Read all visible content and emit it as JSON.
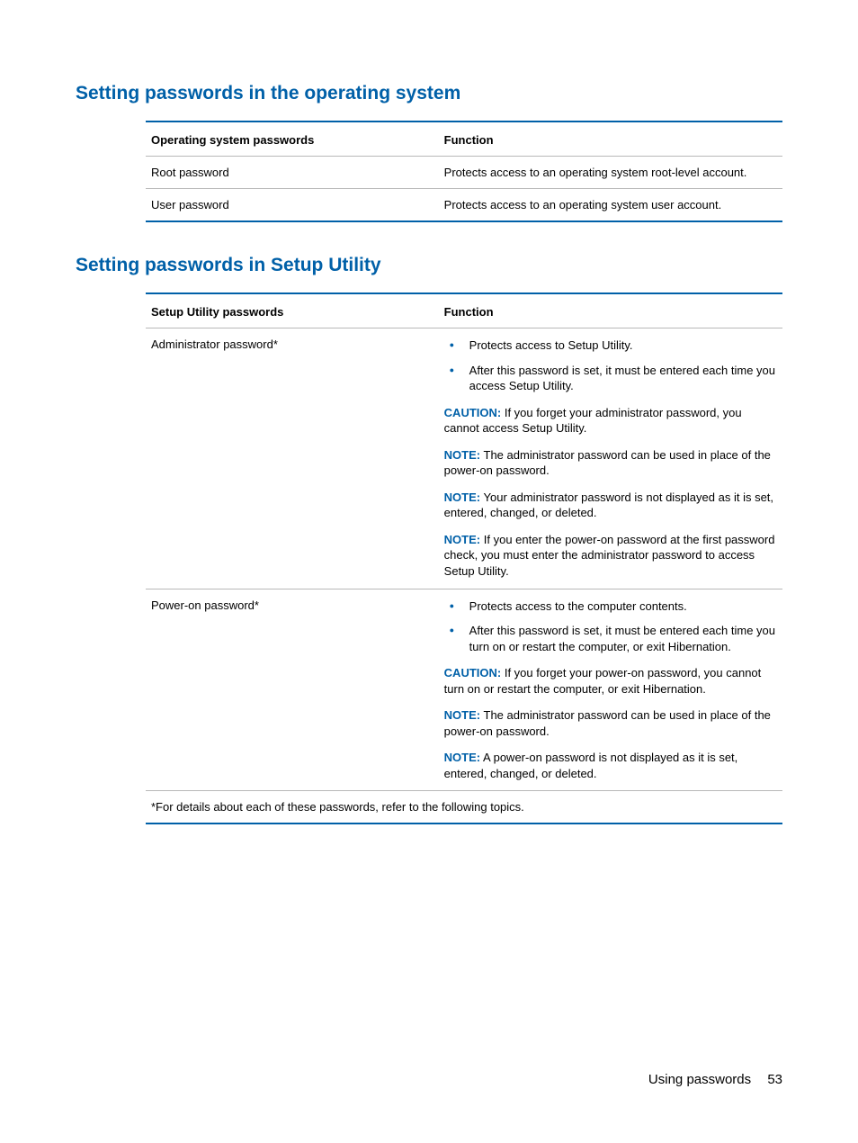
{
  "sections": {
    "os": {
      "heading": "Setting passwords in the operating system",
      "table": {
        "headers": [
          "Operating system passwords",
          "Function"
        ],
        "rows": [
          {
            "name": "Root password",
            "func": "Protects access to an operating system root-level account."
          },
          {
            "name": "User password",
            "func": "Protects access to an operating system user account."
          }
        ]
      }
    },
    "setup": {
      "heading": "Setting passwords in Setup Utility",
      "table": {
        "headers": [
          "Setup Utility passwords",
          "Function"
        ],
        "rows": [
          {
            "name": "Administrator password*",
            "bullets": [
              "Protects access to Setup Utility.",
              "After this password is set, it must be entered each time you access Setup Utility."
            ],
            "notes": [
              {
                "tag": "CAUTION:",
                "text": "If you forget your administrator password, you cannot access Setup Utility."
              },
              {
                "tag": "NOTE:",
                "text": "The administrator password can be used in place of the power-on password."
              },
              {
                "tag": "NOTE:",
                "text": "Your administrator password is not displayed as it is set, entered, changed, or deleted."
              },
              {
                "tag": "NOTE:",
                "text": "If you enter the power-on password at the first password check, you must enter the administrator password to access Setup Utility."
              }
            ]
          },
          {
            "name": "Power-on password*",
            "bullets": [
              "Protects access to the computer contents.",
              "After this password is set, it must be entered each time you turn on or restart the computer, or exit Hibernation."
            ],
            "notes": [
              {
                "tag": "CAUTION:",
                "text": "If you forget your power-on password, you cannot turn on or restart the computer, or exit Hibernation."
              },
              {
                "tag": "NOTE:",
                "text": "The administrator password can be used in place of the power-on password."
              },
              {
                "tag": "NOTE:",
                "text": "A power-on password is not displayed as it is set, entered, changed, or deleted."
              }
            ]
          }
        ],
        "footnote": "*For details about each of these passwords, refer to the following topics."
      }
    }
  },
  "footer": {
    "label": "Using passwords",
    "page": "53"
  }
}
